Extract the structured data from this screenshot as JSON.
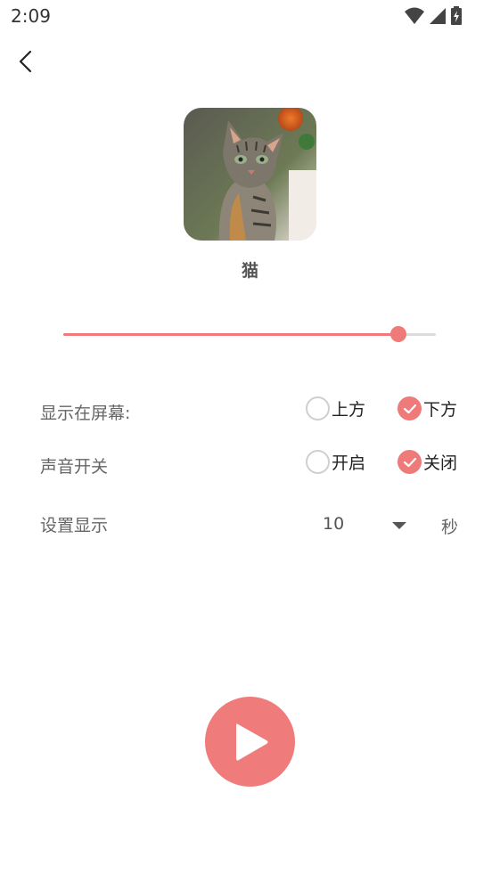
{
  "status_bar": {
    "time": "2:09",
    "icons": [
      "wifi-icon",
      "signal-icon",
      "battery-charging-icon"
    ]
  },
  "header": {
    "back_icon": "chevron-left-icon"
  },
  "profile": {
    "image": "cat-photo",
    "name": "猫"
  },
  "slider": {
    "value_fraction": 0.9,
    "accent": "#ee7a7a",
    "track_color": "#dcdcdc"
  },
  "settings": {
    "display_position": {
      "label": "显示在屏幕:",
      "options": [
        {
          "label": "上方",
          "checked": false
        },
        {
          "label": "下方",
          "checked": true
        }
      ]
    },
    "sound_switch": {
      "label": "声音开关",
      "options": [
        {
          "label": "开启",
          "checked": false
        },
        {
          "label": "关闭",
          "checked": true
        }
      ]
    },
    "display_duration": {
      "label": "设置显示",
      "value": "10",
      "unit": "秒"
    }
  },
  "play_button": {
    "icon": "play-icon",
    "color": "#ef7b7b"
  }
}
